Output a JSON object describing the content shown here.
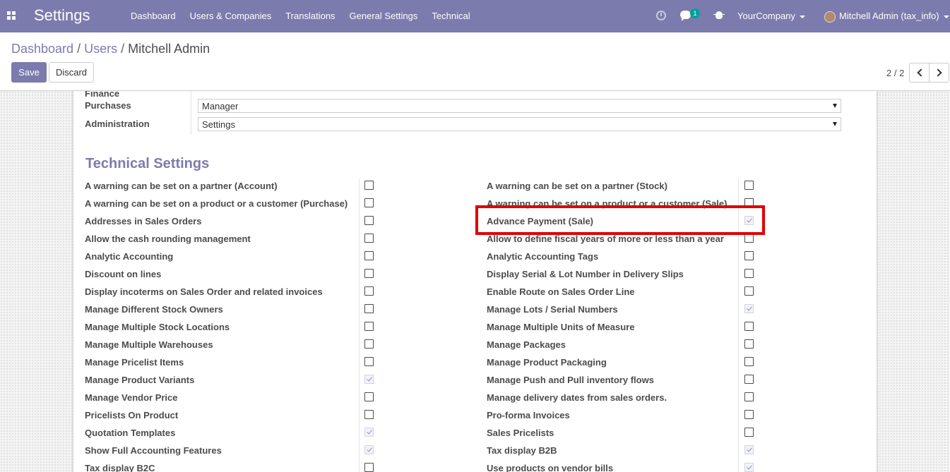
{
  "navbar": {
    "app_title": "Settings",
    "menu": [
      "Dashboard",
      "Users & Companies",
      "Translations",
      "General Settings",
      "Technical"
    ],
    "chat_badge": "1",
    "company": "YourCompany",
    "user": "Mitchell Admin (tax_info)",
    "color": "#7c7bad"
  },
  "breadcrumb": {
    "items": [
      "Dashboard",
      "Users"
    ],
    "current": "Mitchell Admin",
    "separator": "/"
  },
  "buttons": {
    "save": "Save",
    "discard": "Discard"
  },
  "pager": {
    "value": "2 / 2"
  },
  "access_rights": [
    {
      "label": "Finance",
      "value": null
    },
    {
      "label": "Purchases",
      "value": "Manager"
    },
    {
      "label": "Administration",
      "value": "Settings"
    }
  ],
  "technical_settings": {
    "title": "Technical Settings",
    "left": [
      {
        "label": "A warning can be set on a partner (Account)",
        "checked": false
      },
      {
        "label": "A warning can be set on a product or a customer (Purchase)",
        "checked": false
      },
      {
        "label": "Addresses in Sales Orders",
        "checked": false
      },
      {
        "label": "Allow the cash rounding management",
        "checked": false
      },
      {
        "label": "Analytic Accounting",
        "checked": false
      },
      {
        "label": "Discount on lines",
        "checked": false
      },
      {
        "label": "Display incoterms on Sales Order and related invoices",
        "checked": false
      },
      {
        "label": "Manage Different Stock Owners",
        "checked": false
      },
      {
        "label": "Manage Multiple Stock Locations",
        "checked": false
      },
      {
        "label": "Manage Multiple Warehouses",
        "checked": false
      },
      {
        "label": "Manage Pricelist Items",
        "checked": false
      },
      {
        "label": "Manage Product Variants",
        "checked": true
      },
      {
        "label": "Manage Vendor Price",
        "checked": false
      },
      {
        "label": "Pricelists On Product",
        "checked": false
      },
      {
        "label": "Quotation Templates",
        "checked": true
      },
      {
        "label": "Show Full Accounting Features",
        "checked": true
      },
      {
        "label": "Tax display B2C",
        "checked": false
      }
    ],
    "right": [
      {
        "label": "A warning can be set on a partner (Stock)",
        "checked": false
      },
      {
        "label": "A warning can be set on a product or a customer (Sale)",
        "checked": false
      },
      {
        "label": "Advance Payment (Sale)",
        "checked": true
      },
      {
        "label": "Allow to define fiscal years of more or less than a year",
        "checked": false
      },
      {
        "label": "Analytic Accounting Tags",
        "checked": false
      },
      {
        "label": "Display Serial & Lot Number in Delivery Slips",
        "checked": false
      },
      {
        "label": "Enable Route on Sales Order Line",
        "checked": false
      },
      {
        "label": "Manage Lots / Serial Numbers",
        "checked": true
      },
      {
        "label": "Manage Multiple Units of Measure",
        "checked": false
      },
      {
        "label": "Manage Packages",
        "checked": false
      },
      {
        "label": "Manage Product Packaging",
        "checked": false
      },
      {
        "label": "Manage Push and Pull inventory flows",
        "checked": false
      },
      {
        "label": "Manage delivery dates from sales orders.",
        "checked": false
      },
      {
        "label": "Pro-forma Invoices",
        "checked": false
      },
      {
        "label": "Sales Pricelists",
        "checked": false
      },
      {
        "label": "Tax display B2B",
        "checked": true
      },
      {
        "label": "Use products on vendor bills",
        "checked": true
      }
    ]
  },
  "highlight": {
    "color": "#e00000",
    "target": "Advance Payment (Sale)"
  }
}
